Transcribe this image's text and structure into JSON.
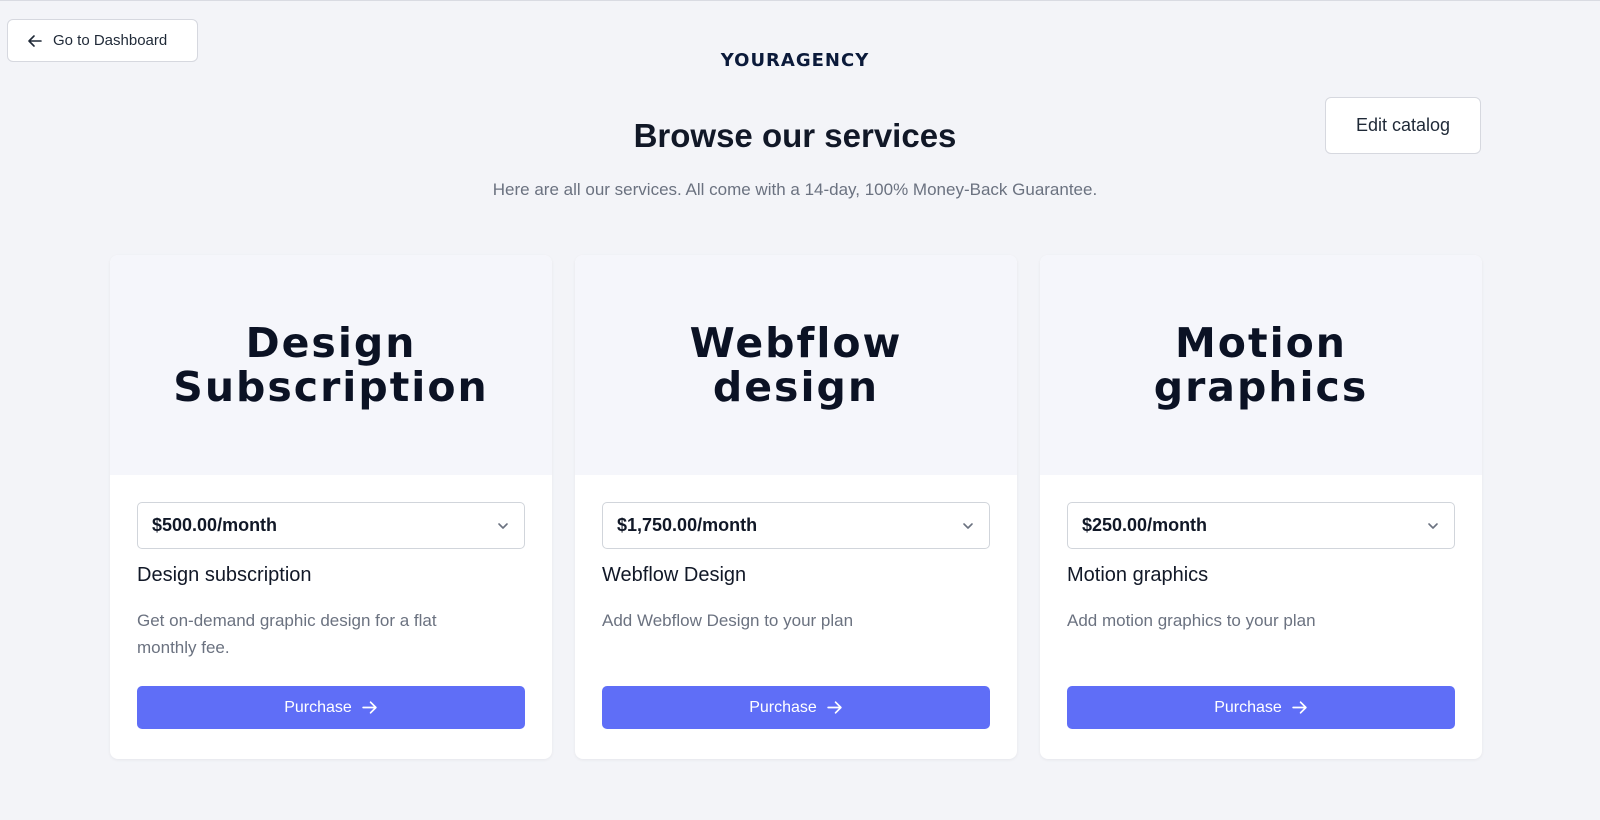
{
  "nav": {
    "back_label": "Go to Dashboard",
    "back_icon": "arrow-left-icon"
  },
  "brand": {
    "name": "YOURAGENCY",
    "color": "#0b1a3a"
  },
  "header": {
    "edit_label": "Edit catalog",
    "title": "Browse our services",
    "subtitle": "Here are all our services. All come with a 14-day, 100% Money-Back Guarantee."
  },
  "accent": "#5f6ef7",
  "services": [
    {
      "hero": "Design\nSubscription",
      "price": "$500.00/month",
      "name": "Design subscription",
      "description": "Get on-demand graphic design for a flat monthly fee.",
      "cta": "Purchase"
    },
    {
      "hero": "Webflow\ndesign",
      "price": "$1,750.00/month",
      "name": "Webflow Design",
      "description": "Add Webflow Design to your plan",
      "cta": "Purchase"
    },
    {
      "hero": "Motion\ngraphics",
      "price": "$250.00/month",
      "name": "Motion graphics",
      "description": "Add motion graphics to your plan",
      "cta": "Purchase"
    }
  ]
}
